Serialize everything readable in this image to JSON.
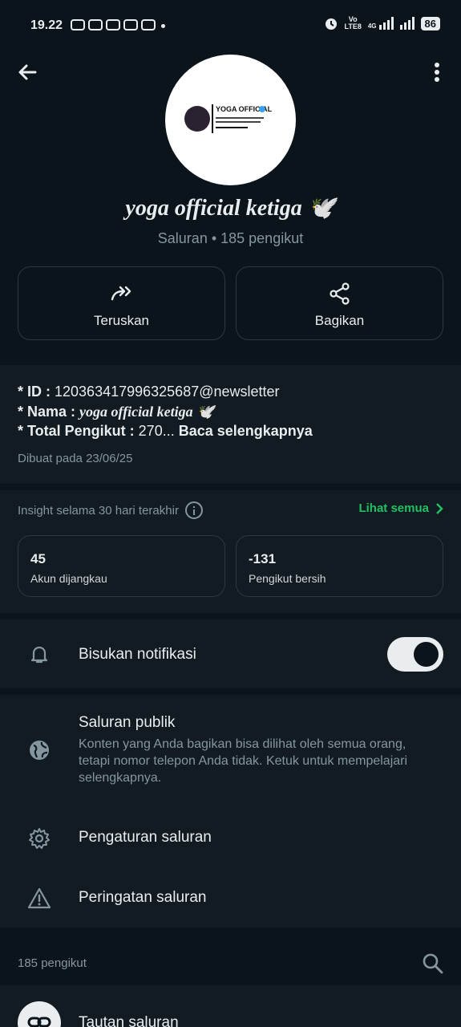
{
  "status_bar": {
    "time": "19.22",
    "battery": "86",
    "volte": "Vo",
    "lte": "LTE8",
    "network": "4G"
  },
  "channel": {
    "name": "yoga official ketiga 🕊️",
    "subtitle": "Saluran • 185 pengikut",
    "avatar_logo_text": "YOGA OFFICIAL"
  },
  "actions": {
    "forward_label": "Teruskan",
    "share_label": "Bagikan"
  },
  "description": {
    "id_key": "* ID : ",
    "id_value": "120363417996325687@newsletter",
    "name_key": "* Nama : ",
    "name_value": "yoga official ketiga 🕊️",
    "total_key": "* Total Pengikut : ",
    "total_value": "270... ",
    "read_more": "Baca selengkapnya",
    "created": "Dibuat pada 23/06/25"
  },
  "insight": {
    "title": "Insight selama 30 hari terakhir",
    "see_all": "Lihat semua",
    "reached_value": "45",
    "reached_label": "Akun dijangkau",
    "net_value": "-131",
    "net_label": "Pengikut bersih"
  },
  "mute": {
    "label": "Bisukan notifikasi",
    "enabled": true
  },
  "settings": {
    "public_title": "Saluran publik",
    "public_desc": "Konten yang Anda bagikan bisa dilihat oleh semua orang, tetapi nomor telepon Anda tidak. Ketuk untuk mempelajari selengkapnya.",
    "channel_settings": "Pengaturan saluran",
    "channel_warning": "Peringatan saluran"
  },
  "followers": {
    "count_label": "185 pengikut",
    "link_label": "Tautan saluran"
  },
  "colors": {
    "background": "#0b141a",
    "section": "#111b21",
    "accent_green": "#21c063",
    "text": "#e9edef",
    "muted": "#8696a0"
  }
}
